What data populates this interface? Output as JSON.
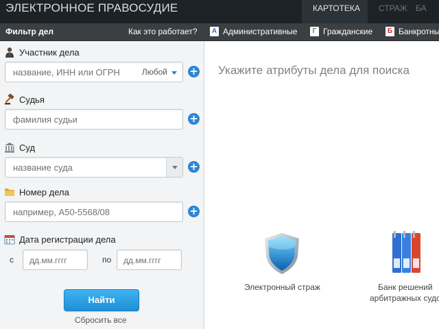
{
  "header": {
    "brand": "ЭЛЕКТРОННОЕ ПРАВОСУДИЕ",
    "tabs": [
      {
        "label": "КАРТОТЕКА",
        "active": true
      },
      {
        "label": "СТРАЖ",
        "active": false
      },
      {
        "label": "БА",
        "active": false
      }
    ]
  },
  "subbar": {
    "filter_title": "Фильтр дел",
    "how_link": "Как это работает?",
    "categories": [
      {
        "badge": "А",
        "label": "Административные",
        "color": "#2c72c7"
      },
      {
        "badge": "Г",
        "label": "Гражданские",
        "color": "#3f9a3a"
      },
      {
        "badge": "Б",
        "label": "Банкротны",
        "color": "#c9302c"
      }
    ]
  },
  "filter": {
    "participant": {
      "label": "Участник дела",
      "placeholder": "название, ИНН или ОГРН",
      "role": "Любой",
      "icon": "user-icon"
    },
    "judge": {
      "label": "Судья",
      "placeholder": "фамилия судьи",
      "icon": "gavel-icon"
    },
    "court": {
      "label": "Суд",
      "placeholder": "название суда",
      "icon": "courthouse-icon"
    },
    "case_number": {
      "label": "Номер дела",
      "placeholder": "например, А50-5568/08",
      "icon": "folder-icon"
    },
    "registration_date": {
      "label": "Дата регистрации дела",
      "from_prefix": "с",
      "to_prefix": "по",
      "from_placeholder": "дд.мм.гггг",
      "to_placeholder": "дд.мм.гггг",
      "icon": "calendar-icon"
    },
    "find_button": "Найти",
    "reset_link": "Сбросить все"
  },
  "main": {
    "hint": "Укажите атрибуты дела для поиска",
    "promos": [
      {
        "caption": "Электронный страж",
        "icon": "shield-icon"
      },
      {
        "caption_line1": "Банк решений",
        "caption_line2": "арбитражных судо",
        "icon": "binders-icon"
      }
    ]
  },
  "colors": {
    "header_bg": "#1d2226",
    "subbar_bg": "#3b3f42",
    "accent": "#2b86d6",
    "button": "#1f8fd6"
  }
}
